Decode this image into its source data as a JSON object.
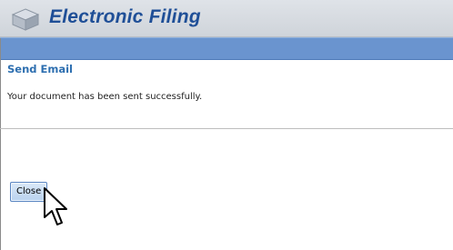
{
  "app": {
    "title": "Electronic Filing",
    "logo_icon": "cube-logo-icon"
  },
  "panel": {
    "section_title": "Send Email",
    "message": "Your document has been sent successfully.",
    "close_label": "Close"
  },
  "colors": {
    "title_text": "#1f4f97",
    "blue_bar": "#6a94cf",
    "section_title": "#2e6fb0"
  },
  "cursor": "arrow-pointer-icon"
}
